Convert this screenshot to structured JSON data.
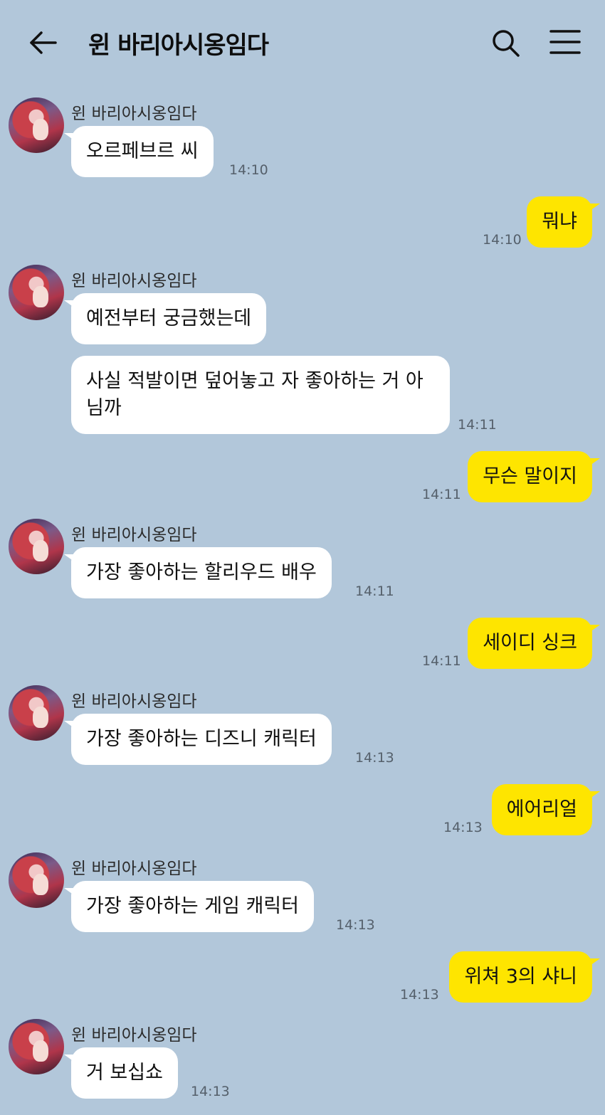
{
  "header": {
    "title": "윈 바리아시옹임다"
  },
  "icons": {
    "back": "back-arrow-icon",
    "search": "search-icon",
    "menu": "hamburger-menu-icon"
  },
  "colors": {
    "background": "#b2c7da",
    "received_bubble": "#ffffff",
    "sent_bubble": "#fee500"
  },
  "messages": [
    {
      "sender": "윈 바리아시옹임다",
      "text": "오르페브르 씨",
      "time": "14:10"
    },
    {
      "text": "뭐냐",
      "time": "14:10"
    },
    {
      "sender": "윈 바리아시옹임다",
      "text": "예전부터 궁금했는데"
    },
    {
      "text": "사실 적발이면 덮어놓고 자 좋아하는 거 아님까",
      "time": "14:11"
    },
    {
      "text": "무슨 말이지",
      "time": "14:11"
    },
    {
      "sender": "윈 바리아시옹임다",
      "text": "가장 좋아하는 할리우드 배우",
      "time": "14:11"
    },
    {
      "text": "세이디 싱크",
      "time": "14:11"
    },
    {
      "sender": "윈 바리아시옹임다",
      "text": "가장 좋아하는 디즈니 캐릭터",
      "time": "14:13"
    },
    {
      "text": "에어리얼",
      "time": "14:13"
    },
    {
      "sender": "윈 바리아시옹임다",
      "text": "가장 좋아하는 게임 캐릭터",
      "time": "14:13"
    },
    {
      "text": "위쳐 3의 샤니",
      "time": "14:13"
    },
    {
      "sender": "윈 바리아시옹임다",
      "text": "거 보십쇼",
      "time": "14:13"
    }
  ]
}
